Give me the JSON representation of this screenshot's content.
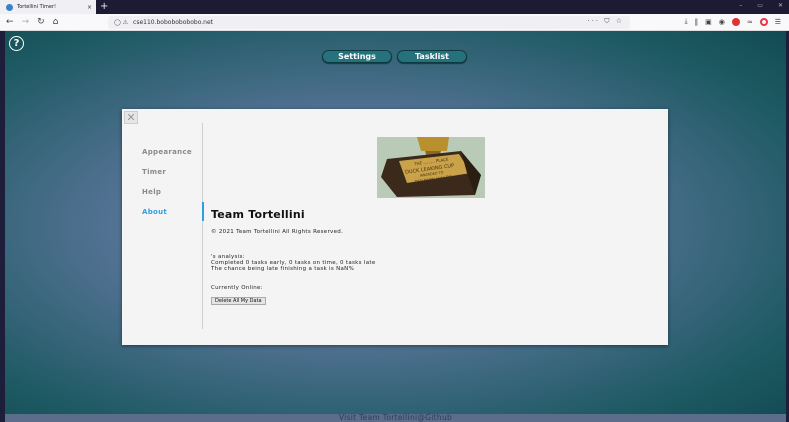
{
  "browser": {
    "tab_title": "Tortellini Timer!",
    "tab_close": "×",
    "new_tab": "+",
    "window_buttons": [
      "–",
      "▭",
      "✕"
    ],
    "url": "cse110.bobobobobobo.net",
    "url_actions": "··· ⛉ ☆",
    "toolbar_icons": [
      "download-icon",
      "library-icon",
      "sidebar-icon",
      "account-icon",
      "addon-red-icon",
      "wifi-icon",
      "addon-ring-icon",
      "menu-icon"
    ]
  },
  "app": {
    "help_label": "?",
    "settings_label": "Settings",
    "tasklist_label": "Tasklist",
    "footer_text": "Visit Team Tortellini@Github"
  },
  "modal": {
    "close_label": "✕",
    "nav": [
      "Appearance",
      "Timer",
      "Help",
      "About"
    ],
    "active_nav": "About",
    "about": {
      "title": "Team Tortellini",
      "copyright": "© 2021 Team Tortellini All Rights Reserved.",
      "analysis_header": "'s analysis:",
      "analysis_line1": "Completed 0 tasks early, 0 tasks on time, 0 tasks late",
      "analysis_line2": "The chance being late finishing a task is NaN%",
      "online_label": "Currently Online:",
      "delete_button": "Delete All My Data"
    },
    "trophy_plaque": [
      "THE ......... PLACE",
      "DUCK LEAKING CUP",
      "AWARDED TO",
      "DOLPHIN HILLDS"
    ]
  },
  "colors": {
    "accent": "#2f9ee0",
    "button_teal": "#25717c"
  }
}
